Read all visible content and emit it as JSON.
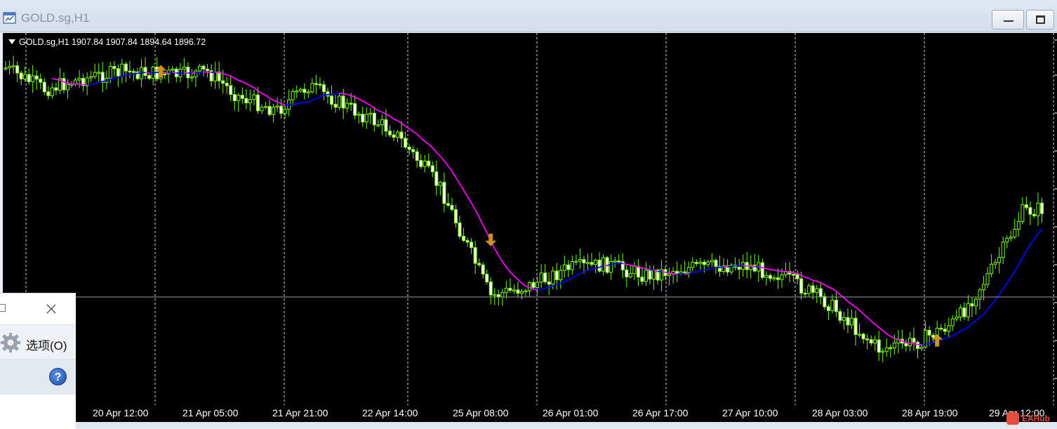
{
  "window": {
    "title": "GOLD.sg,H1"
  },
  "chart": {
    "info_line": "GOLD.sg,H1  1907.84 1907.84 1894.64 1896.72",
    "colors": {
      "background": "#000000",
      "candle": "#7cfc00",
      "candle_bull_body": "#000000",
      "candle_bear_body": "#ffffff",
      "grid": "#ffffff",
      "ma_up": "#0000ff",
      "ma_down": "#ff00ff",
      "arrow": "#c8941a",
      "bid_line": "#9aa0a6"
    },
    "x_labels": [
      "20 Apr 12:00",
      "21 Apr 05:00",
      "21 Apr 21:00",
      "22 Apr 14:00",
      "25 Apr 08:00",
      "26 Apr 01:00",
      "26 Apr 17:00",
      "27 Apr 10:00",
      "28 Apr 03:00",
      "28 Apr 19:00",
      "29 Apr 12:00"
    ],
    "arrows": [
      {
        "dir": "up",
        "bar": 40
      },
      {
        "dir": "down",
        "bar": 125
      },
      {
        "dir": "up",
        "bar": 240
      }
    ]
  },
  "popup": {
    "options_label": "选项(O)",
    "help_label": "?"
  },
  "watermark": {
    "text": "EAHub"
  }
}
